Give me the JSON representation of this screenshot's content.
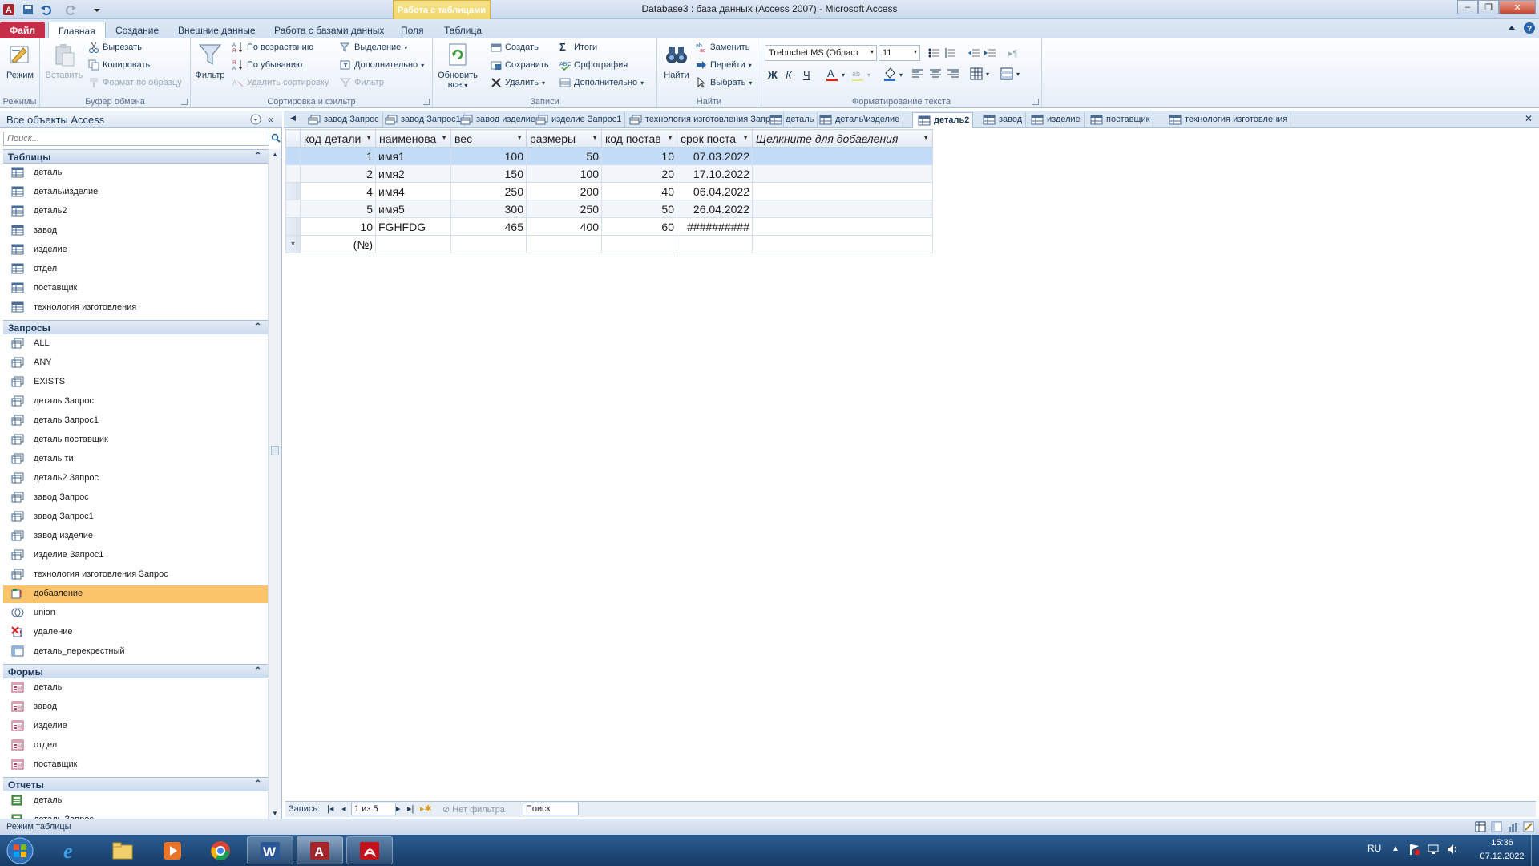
{
  "window": {
    "title": "Database3 : база данных (Access 2007)  -  Microsoft Access",
    "context_tab": "Работа с таблицами"
  },
  "ribbon_tabs": [
    "Файл",
    "Главная",
    "Создание",
    "Внешние данные",
    "Работа с базами данных",
    "Поля",
    "Таблица"
  ],
  "ribbon": {
    "modes": {
      "view": "Режим",
      "label": "Режимы"
    },
    "clipboard": {
      "paste": "Вставить",
      "cut": "Вырезать",
      "copy": "Копировать",
      "format_painter": "Формат по образцу",
      "label": "Буфер обмена"
    },
    "sort_filter": {
      "filter": "Фильтр",
      "ascending": "По возрастанию",
      "descending": "По убыванию",
      "remove_sort": "Удалить сортировку",
      "selection": "Выделение",
      "advanced": "Дополнительно",
      "toggle_filter": "Фильтр",
      "label": "Сортировка и фильтр"
    },
    "records": {
      "refresh": "Обновить",
      "refresh2": "все",
      "new": "Создать",
      "save": "Сохранить",
      "delete": "Удалить",
      "totals": "Итоги",
      "spelling": "Орфография",
      "more": "Дополнительно",
      "label": "Записи"
    },
    "find": {
      "find": "Найти",
      "replace": "Заменить",
      "goto": "Перейти",
      "select": "Выбрать",
      "label": "Найти"
    },
    "text_format": {
      "font": "Trebuchet MS (Област",
      "size": "11",
      "bold": "Ж",
      "italic": "К",
      "underline": "Ч",
      "label": "Форматирование текста"
    }
  },
  "nav_pane": {
    "header": "Все объекты Access",
    "search_placeholder": "Поиск...",
    "sections": [
      {
        "title": "Таблицы",
        "items": [
          "деталь",
          "деталь\\изделие",
          "деталь2",
          "завод",
          "изделие",
          "отдел",
          "поставщик",
          "технология изготовления"
        ]
      },
      {
        "title": "Запросы",
        "items": [
          "ALL",
          "ANY",
          "EXISTS",
          "деталь Запрос",
          "деталь Запрос1",
          "деталь поставщик",
          "деталь ти",
          "деталь2 Запрос",
          "завод Запрос",
          "завод Запрос1",
          "завод изделие",
          "изделие Запрос1",
          "технология изготовления Запрос",
          "добавление",
          "union",
          "удаление",
          "деталь_перекрестный"
        ]
      },
      {
        "title": "Формы",
        "items": [
          "деталь",
          "завод",
          "изделие",
          "отдел",
          "поставщик"
        ]
      },
      {
        "title": "Отчеты",
        "items": [
          "деталь",
          "деталь Запрос"
        ]
      }
    ],
    "selected_item": "добавление"
  },
  "doc_tabs": [
    "завод Запрос",
    "завод Запрос1",
    "завод изделие",
    "изделие Запрос1",
    "технология изготовления Запрос",
    "деталь",
    "деталь\\изделие",
    "деталь2",
    "завод",
    "изделие",
    "поставщик",
    "технология изготовления"
  ],
  "active_doc_tab": "деталь2",
  "datasheet": {
    "columns": [
      "код детали",
      "наименова",
      "вес",
      "размеры",
      "код постав",
      "срок поста",
      "Щелкните для добавления"
    ],
    "rows": [
      [
        "1",
        "имя1",
        "100",
        "50",
        "10",
        "07.03.2022"
      ],
      [
        "2",
        "имя2",
        "150",
        "100",
        "20",
        "17.10.2022"
      ],
      [
        "4",
        "имя4",
        "250",
        "200",
        "40",
        "06.04.2022"
      ],
      [
        "5",
        "имя5",
        "300",
        "250",
        "50",
        "26.04.2022"
      ],
      [
        "10",
        "FGHFDG",
        "465",
        "400",
        "60",
        "##########"
      ]
    ],
    "new_row_marker": "*",
    "new_row_value": "(№)"
  },
  "record_nav": {
    "label": "Запись:",
    "position": "1 из 5",
    "filter": "Нет фильтра",
    "search": "Поиск"
  },
  "status": {
    "text": "Режим таблицы"
  },
  "taskbar": {
    "lang": "RU",
    "time": "15:36",
    "date": "07.12.2022"
  }
}
